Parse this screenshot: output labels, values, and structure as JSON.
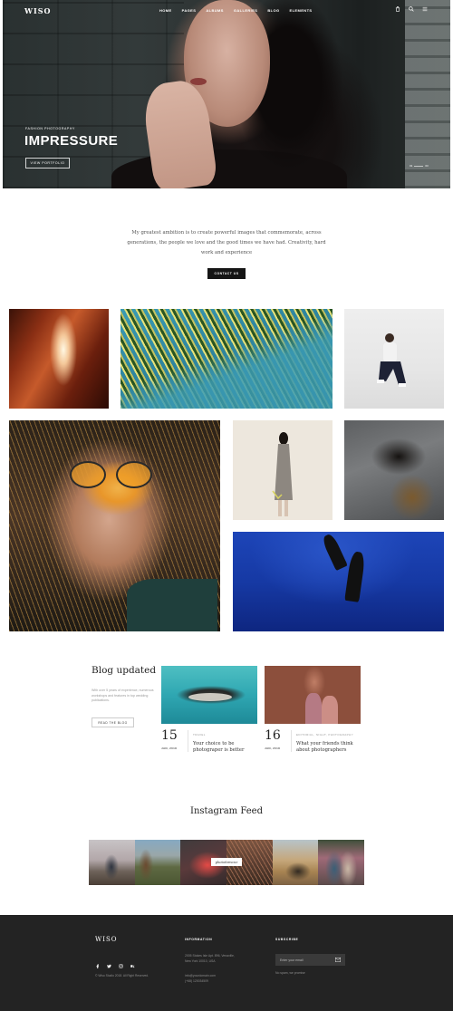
{
  "nav": {
    "logo": "WISO",
    "menu": [
      "HOME",
      "PAGES",
      "ALBUMS",
      "GALLERIES",
      "BLOG",
      "ELEMENTS"
    ],
    "icons": [
      "bag-icon",
      "search-icon",
      "menu-icon"
    ]
  },
  "hero": {
    "subtitle": "FASHION PHOTOGRAPHY",
    "title": "IMPRESSURE",
    "button": "VIEW PORTFOLIO",
    "pager_current": "01",
    "pager_total": "03"
  },
  "intro": {
    "text": "My greatest ambition is to create powerful images that commemorate, across generations, the people we love and the good times we have had. Creativity, hard work and experience",
    "button": "CONTACT US"
  },
  "blog": {
    "title": "Blog updated",
    "text": "With over 5 years of experience, numerous workshops and features in top wedding publications.",
    "button": "READ THE BLOG",
    "posts": [
      {
        "day": "15",
        "date": "JAN, 2018",
        "category": "TRAVEL",
        "headline": "Your choice to be photograper is better"
      },
      {
        "day": "16",
        "date": "JAN, 2018",
        "category": "EDITORIAL, NIGHT, PHOTOGRAPHY",
        "headline": "What your friends think about photographers"
      }
    ]
  },
  "instagram": {
    "title": "Instagram Feed",
    "label": "photo6rescur"
  },
  "footer": {
    "logo": "WISO",
    "copyright": "© Wiso Studio 2018. All Right Reserved.",
    "info_heading": "INFORMATION",
    "address_line1": "2005 Stokes Isle Apt. 896, Venaville,",
    "address_line2": "New York 10010, USA",
    "email": "info@yourdomain.com",
    "phone": "(+68) 120034509",
    "subscribe_heading": "SUBSCRIBE",
    "email_placeholder": "Enter your email",
    "spam_note": "No spam, we promise",
    "social_icons": [
      "facebook-icon",
      "twitter-icon",
      "instagram-icon",
      "behance-icon"
    ]
  }
}
